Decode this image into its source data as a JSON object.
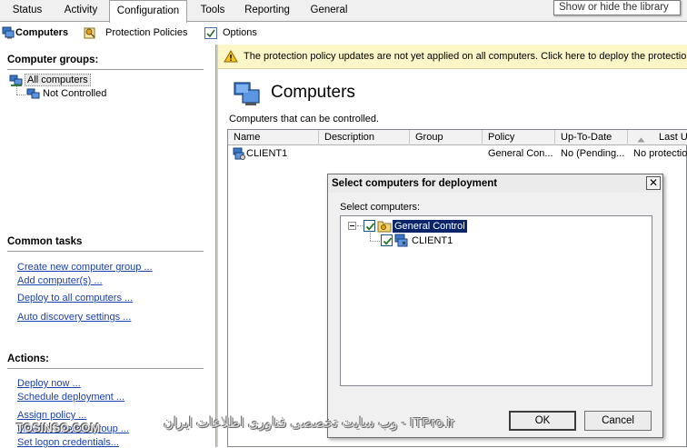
{
  "tabs": [
    {
      "label": "Status",
      "active": false
    },
    {
      "label": "Activity",
      "active": false
    },
    {
      "label": "Configuration",
      "active": true
    },
    {
      "label": "Tools",
      "active": false
    },
    {
      "label": "Reporting",
      "active": false
    },
    {
      "label": "General",
      "active": false
    }
  ],
  "library_button": "Show or hide the library",
  "toolbar": {
    "computers": "Computers",
    "protection_policies": "Protection Policies",
    "options": "Options"
  },
  "left": {
    "groups_title": "Computer groups:",
    "groups": [
      "All computers",
      "Not Controlled"
    ],
    "common_tasks_title": "Common tasks",
    "common_tasks": [
      "Create new computer group ...",
      "Add computer(s) ...",
      "Deploy to all computers ...",
      "Auto discovery settings ..."
    ],
    "actions_title": "Actions:",
    "actions": [
      "Deploy now ...",
      "Schedule deployment ...",
      "Assign policy ...",
      "Move to another group ...",
      "Set logon credentials..."
    ]
  },
  "warning": "The protection policy updates are not yet applied on all computers. Click here to deploy the protection policy",
  "main": {
    "title": "Computers",
    "subtitle": "Computers that can be controlled.",
    "columns": [
      "Name",
      "Description",
      "Group",
      "Policy",
      "Up-To-Date",
      "Last U"
    ],
    "rows": [
      {
        "name": "CLIENT1",
        "description": "",
        "group": "",
        "policy": "General Con...",
        "uptodate": "No (Pending...",
        "last": "No protectio"
      }
    ]
  },
  "dialog": {
    "title": "Select computers for deployment",
    "close": "✕",
    "label": "Select computers:",
    "tree_root": "General Control",
    "tree_child": "CLIENT1",
    "ok": "OK",
    "cancel": "Cancel"
  },
  "watermark": {
    "right": "ITPro.ir - وب سایت تخصصی فناوری اطلاعات ایران",
    "left": "TOSINSO.COM"
  },
  "colors": {
    "link": "#1a3fae",
    "warning_bg": "#fdf6c8",
    "selection": "#0a246a"
  }
}
